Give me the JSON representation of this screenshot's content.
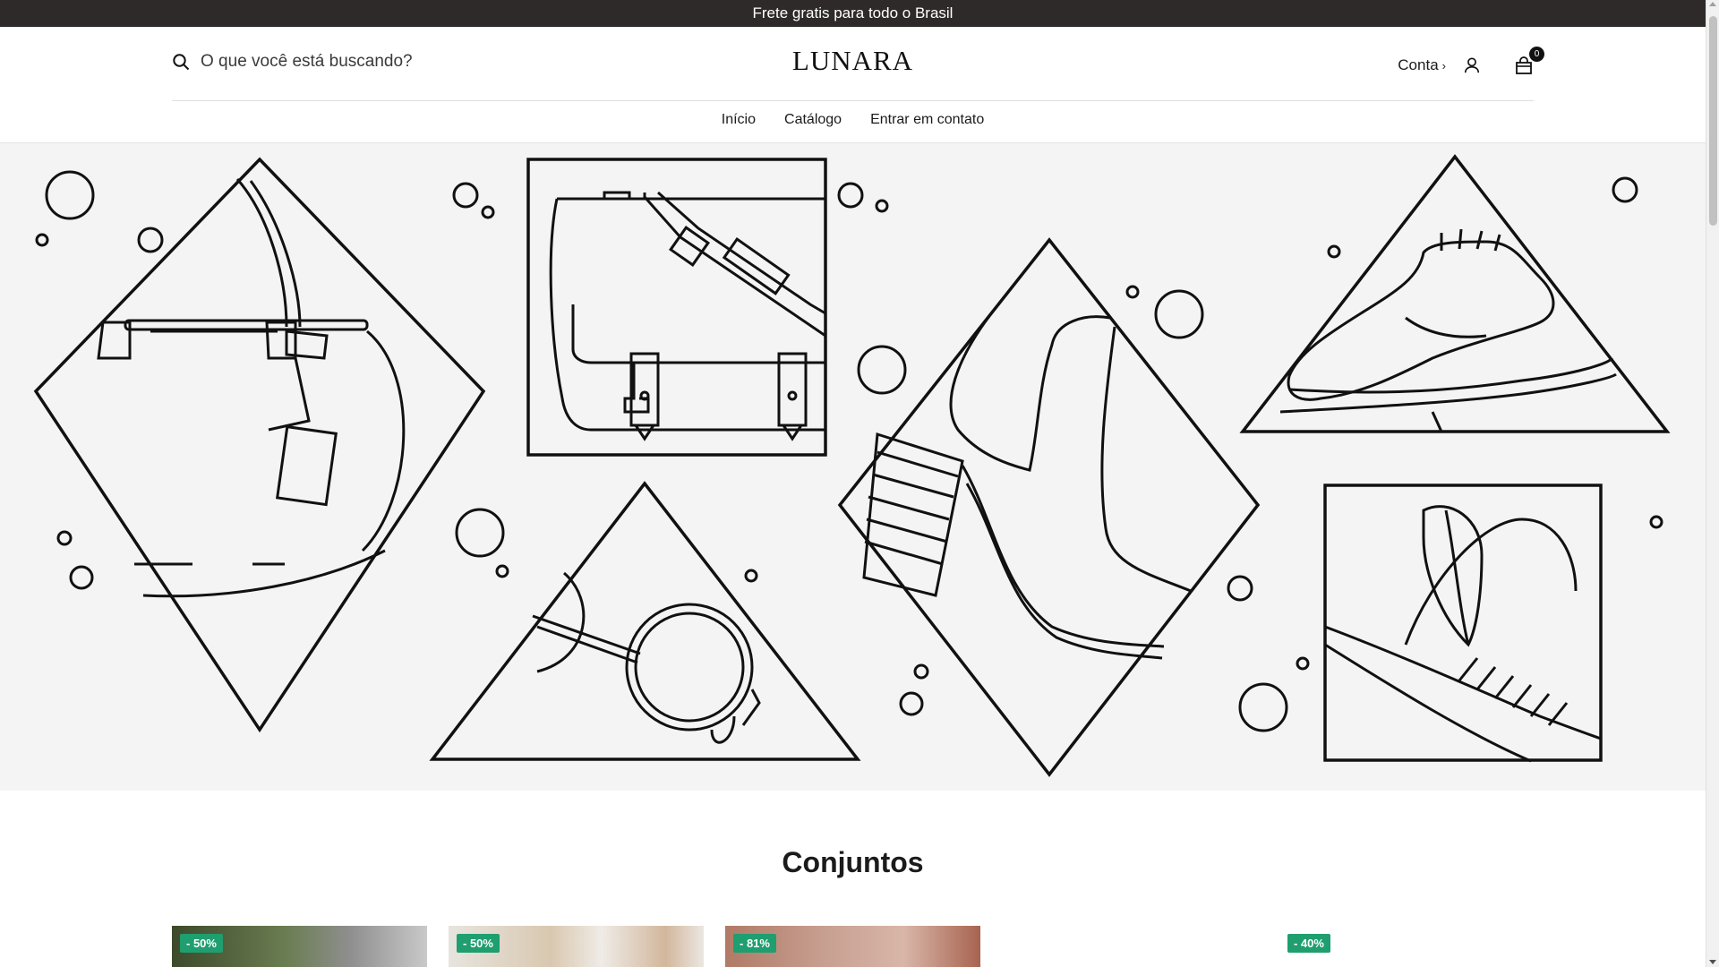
{
  "announcement": {
    "text": "Frete gratis para todo o Brasil"
  },
  "header": {
    "search_placeholder": "O que você está buscando?",
    "logo": "LUNARA",
    "account_label": "Conta",
    "account_chevron": "›",
    "cart_count": "0",
    "icons": [
      "search-icon",
      "user-icon",
      "shopping-bag-icon"
    ]
  },
  "nav": {
    "items": [
      "Início",
      "Catálogo",
      "Entrar em contato"
    ]
  },
  "collection": {
    "title": "Conjuntos"
  },
  "products": [
    {
      "badge": "- 50%"
    },
    {
      "badge": "- 50%"
    },
    {
      "badge": "- 81%"
    },
    {
      "badge": "- 40%"
    }
  ],
  "colors": {
    "announcement_bg": "#2f2a2a",
    "badge_green": "#1f9e6f",
    "hero_bg": "#f4f4f4"
  }
}
